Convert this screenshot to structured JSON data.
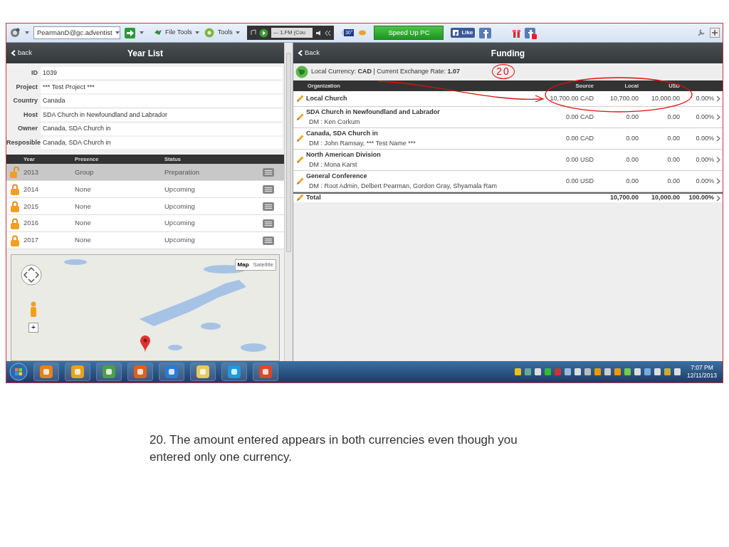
{
  "toolbar": {
    "account": "PearmanD@gc.adventist",
    "file_tools": "File Tools",
    "tools": "Tools",
    "radio_station": "--- 1.FM (Cou",
    "weather": "30°",
    "speed_up": "Speed Up PC",
    "like": "Like"
  },
  "year_list": {
    "back": "back",
    "title": "Year List",
    "fields": [
      {
        "label": "ID",
        "value": "1039"
      },
      {
        "label": "Project",
        "value": "*** Test Project ***"
      },
      {
        "label": "Country",
        "value": "Canada"
      },
      {
        "label": "Host",
        "value": "SDA Church in Newfoundland and Labrador"
      },
      {
        "label": "Owner",
        "value": "Canada, SDA Church in"
      },
      {
        "label": "Resposible",
        "value": "Canada, SDA Church in"
      }
    ],
    "columns": [
      "Year",
      "Presence",
      "Status"
    ],
    "rows": [
      {
        "year": "2013",
        "presence": "Group",
        "status": "Preparation",
        "selected": true,
        "locked": false
      },
      {
        "year": "2014",
        "presence": "None",
        "status": "Upcoming",
        "selected": false,
        "locked": true
      },
      {
        "year": "2015",
        "presence": "None",
        "status": "Upcoming",
        "selected": false,
        "locked": true
      },
      {
        "year": "2016",
        "presence": "None",
        "status": "Upcoming",
        "selected": false,
        "locked": true
      },
      {
        "year": "2017",
        "presence": "None",
        "status": "Upcoming",
        "selected": false,
        "locked": true
      }
    ],
    "map": {
      "types": [
        {
          "label": "Map",
          "selected": true
        },
        {
          "label": "Satellite",
          "selected": false
        }
      ],
      "zoom_in": "+"
    }
  },
  "funding": {
    "back": "Back",
    "title": "Funding",
    "currency_line": "Local Currency: **CAD** | Current Exchange Rate: **1.07**",
    "columns": [
      "Organization",
      "Source",
      "Local",
      "USD"
    ],
    "rows": [
      {
        "name": "Local Church",
        "source": "10,700.00 CAD",
        "local": "10,700.00",
        "usd": "10,000.00",
        "percent": "0.00%"
      },
      {
        "name": "SDA Church in Newfoundland and Labrador",
        "dm": "DM : Ken Corkum",
        "source": "0.00 CAD",
        "local": "0.00",
        "usd": "0.00",
        "percent": "0.00%"
      },
      {
        "name": "Canada, SDA Church in",
        "dm": "DM : John Ramsay, *** Test Name ***",
        "source": "0.00 CAD",
        "local": "0.00",
        "usd": "0.00",
        "percent": "0.00%"
      },
      {
        "name": "North American Division",
        "dm": "DM : Mona Karst",
        "source": "0.00 USD",
        "local": "0.00",
        "usd": "0.00",
        "percent": "0.00%"
      },
      {
        "name": "General Conference",
        "dm": "DM : Root Admin, Delbert Pearman, Gordon Gray, Shyamala Ram",
        "source": "0.00 USD",
        "local": "0.00",
        "usd": "0.00",
        "percent": "0.00%"
      }
    ],
    "total": {
      "name": "Total",
      "local": "10,700.00",
      "usd": "10,000.00",
      "percent": "100.00%"
    }
  },
  "annotation": {
    "label": "20"
  },
  "taskbar": {
    "apps": [
      {
        "color": "#e8801a"
      },
      {
        "color": "#e8a21a"
      },
      {
        "color": "#4aa04a"
      },
      {
        "color": "#e0601a"
      },
      {
        "color": "#2a7ad8"
      },
      {
        "color": "#e8c860"
      },
      {
        "color": "#1a9ae0"
      },
      {
        "color": "#d84a2a"
      }
    ],
    "time": "7:07 PM",
    "date": "12/11/2013"
  },
  "caption": "20.  The amount entered appears in both currencies even though you entered only one currency."
}
